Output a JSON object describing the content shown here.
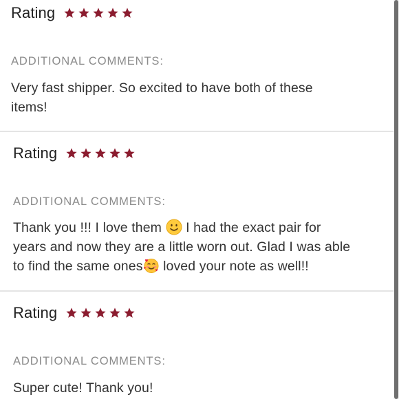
{
  "colors": {
    "star": "#8b1c2f",
    "label_gray": "#8b8b8b",
    "text": "#333333",
    "divider": "#e4e4e4"
  },
  "reviews": [
    {
      "rating_label": "Rating",
      "rating_value": 5,
      "comments_label": "ADDITIONAL COMMENTS:",
      "comment_lines": [
        "Very fast shipper. So excited to have both of these",
        "items!"
      ]
    },
    {
      "rating_label": "Rating",
      "rating_value": 5,
      "comments_label": "ADDITIONAL COMMENTS:",
      "comment_parts": {
        "line1_a": "Thank you !!! I love them ",
        "line1_b": " I had the exact pair for",
        "line2": "years and now they are a little worn out. Glad I was able",
        "line3_a": "to find the same ones",
        "line3_b": " loved your note as well!!"
      },
      "emojis": [
        "slightly-smiling-face-icon",
        "smiling-face-with-hearts-icon"
      ]
    },
    {
      "rating_label": "Rating",
      "rating_value": 5,
      "comments_label": "ADDITIONAL COMMENTS:",
      "comment_lines": [
        "Super cute! Thank you!"
      ]
    }
  ]
}
